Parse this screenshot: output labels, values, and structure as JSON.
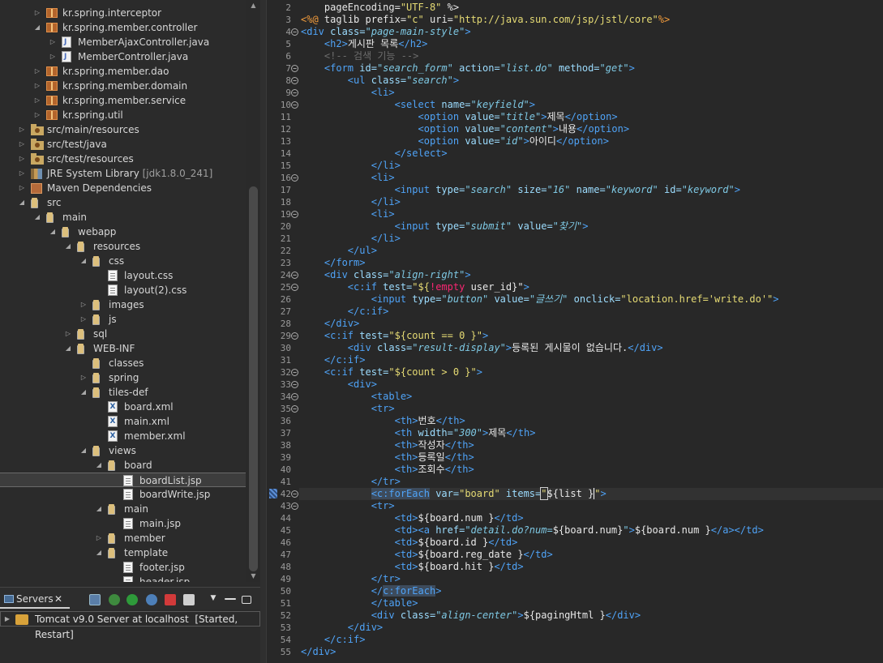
{
  "explorer": {
    "items": [
      {
        "label": "kr.spring.interceptor",
        "icon": "package-icon",
        "indent": 0,
        "expanded": false
      },
      {
        "label": "kr.spring.member.controller",
        "icon": "package-icon",
        "indent": 0,
        "expanded": true
      },
      {
        "label": "MemberAjaxController.java",
        "icon": "java-file-icon",
        "indent": 1,
        "expanded": false
      },
      {
        "label": "MemberController.java",
        "icon": "java-file-icon",
        "indent": 1,
        "expanded": false
      },
      {
        "label": "kr.spring.member.dao",
        "icon": "package-icon",
        "indent": 0,
        "expanded": false
      },
      {
        "label": "kr.spring.member.domain",
        "icon": "package-icon",
        "indent": 0,
        "expanded": false
      },
      {
        "label": "kr.spring.member.service",
        "icon": "package-icon",
        "indent": 0,
        "expanded": false
      },
      {
        "label": "kr.spring.util",
        "icon": "package-icon",
        "indent": 0,
        "expanded": false
      },
      {
        "label": "src/main/resources",
        "icon": "source-folder-icon",
        "indent": -1,
        "expanded": false
      },
      {
        "label": "src/test/java",
        "icon": "source-folder-icon",
        "indent": -1,
        "expanded": false
      },
      {
        "label": "src/test/resources",
        "icon": "source-folder-icon",
        "indent": -1,
        "expanded": false
      },
      {
        "label": "JRE System Library",
        "suffix": "[jdk1.8.0_241]",
        "icon": "library-icon",
        "indent": -1,
        "expanded": false
      },
      {
        "label": "Maven Dependencies",
        "icon": "maven-icon",
        "indent": -1,
        "expanded": false
      },
      {
        "label": "src",
        "icon": "folder-icon",
        "indent": -1,
        "expanded": true
      },
      {
        "label": "main",
        "icon": "folder-icon",
        "indent": 0,
        "expanded": true
      },
      {
        "label": "webapp",
        "icon": "folder-icon",
        "indent": 1,
        "expanded": true
      },
      {
        "label": "resources",
        "icon": "folder-icon",
        "indent": 2,
        "expanded": true
      },
      {
        "label": "css",
        "icon": "folder-icon",
        "indent": 3,
        "expanded": true
      },
      {
        "label": "layout.css",
        "icon": "file-icon",
        "indent": 4,
        "expanded": null
      },
      {
        "label": "layout(2).css",
        "icon": "file-icon",
        "indent": 4,
        "expanded": null
      },
      {
        "label": "images",
        "icon": "folder-icon",
        "indent": 3,
        "expanded": false
      },
      {
        "label": "js",
        "icon": "folder-icon",
        "indent": 3,
        "expanded": false
      },
      {
        "label": "sql",
        "icon": "folder-icon",
        "indent": 2,
        "expanded": false
      },
      {
        "label": "WEB-INF",
        "icon": "folder-icon",
        "indent": 2,
        "expanded": true
      },
      {
        "label": "classes",
        "icon": "folder-icon",
        "indent": 3,
        "expanded": null
      },
      {
        "label": "spring",
        "icon": "folder-icon",
        "indent": 3,
        "expanded": false
      },
      {
        "label": "tiles-def",
        "icon": "folder-icon",
        "indent": 3,
        "expanded": true
      },
      {
        "label": "board.xml",
        "icon": "xml-file-icon",
        "indent": 4,
        "expanded": null
      },
      {
        "label": "main.xml",
        "icon": "xml-file-icon",
        "indent": 4,
        "expanded": null
      },
      {
        "label": "member.xml",
        "icon": "xml-file-icon",
        "indent": 4,
        "expanded": null
      },
      {
        "label": "views",
        "icon": "folder-icon",
        "indent": 3,
        "expanded": true
      },
      {
        "label": "board",
        "icon": "folder-icon",
        "indent": 4,
        "expanded": true
      },
      {
        "label": "boardList.jsp",
        "icon": "jsp-file-icon",
        "indent": 5,
        "expanded": null,
        "selected": true
      },
      {
        "label": "boardWrite.jsp",
        "icon": "jsp-file-icon",
        "indent": 5,
        "expanded": null
      },
      {
        "label": "main",
        "icon": "folder-icon",
        "indent": 4,
        "expanded": true
      },
      {
        "label": "main.jsp",
        "icon": "jsp-file-icon",
        "indent": 5,
        "expanded": null
      },
      {
        "label": "member",
        "icon": "folder-icon",
        "indent": 4,
        "expanded": false
      },
      {
        "label": "template",
        "icon": "folder-icon",
        "indent": 4,
        "expanded": true
      },
      {
        "label": "footer.jsp",
        "icon": "jsp-file-icon",
        "indent": 5,
        "expanded": null
      },
      {
        "label": "header.jsp",
        "icon": "jsp-file-icon",
        "indent": 5,
        "expanded": null
      }
    ]
  },
  "servers": {
    "tab_label": "Servers",
    "close_glyph": "✕",
    "server_label": "Tomcat v9.0 Server at localhost",
    "server_status": "[Started, Restart]"
  },
  "editor": {
    "lines": [
      {
        "n": "2",
        "fold": false,
        "html": "    <span style='color:#e8e8e8'>pageEncoding=</span><span style='color:#e6db74'>\"UTF-8\"</span><span style='color:#e8e8e8'> %&gt;</span>"
      },
      {
        "n": "3",
        "fold": false,
        "html": "<span style='color:#f39c3c'>&lt;%@</span> <span style='color:#e8e8e8'>taglib prefix=</span><span style='color:#e6db74'>\"c\"</span> <span style='color:#e8e8e8'>uri=</span><span style='color:#e6db74'>\"http://java.sun.com/jsp/jstl/core\"</span><span style='color:#f39c3c'>%&gt;</span>"
      },
      {
        "n": "4",
        "fold": true,
        "html": "<span style='color:#4fa3f7'>&lt;div</span> <span style='color:#9cdcfe'>class=</span><span style='color:#7ec8e3;font-style:italic'>\"page-main-style\"</span><span style='color:#4fa3f7'>&gt;</span>"
      },
      {
        "n": "5",
        "fold": false,
        "html": "    <span style='color:#4fa3f7'>&lt;h2&gt;</span>게시판 목록<span style='color:#4fa3f7'>&lt;/h2&gt;</span>"
      },
      {
        "n": "6",
        "fold": false,
        "html": "    <span style='color:#6d6d6d'>&lt;!-- 검색 기능 --&gt;</span>"
      },
      {
        "n": "7",
        "fold": true,
        "html": "    <span style='color:#4fa3f7'>&lt;form</span> <span style='color:#9cdcfe'>id=</span><span style='color:#7ec8e3;font-style:italic'>\"search_form\"</span> <span style='color:#9cdcfe'>action=</span><span style='color:#7ec8e3;font-style:italic'>\"list.do\"</span> <span style='color:#9cdcfe'>method=</span><span style='color:#7ec8e3;font-style:italic'>\"get\"</span><span style='color:#4fa3f7'>&gt;</span>"
      },
      {
        "n": "8",
        "fold": true,
        "html": "        <span style='color:#4fa3f7'>&lt;ul</span> <span style='color:#9cdcfe'>class=</span><span style='color:#7ec8e3;font-style:italic'>\"search\"</span><span style='color:#4fa3f7'>&gt;</span>"
      },
      {
        "n": "9",
        "fold": true,
        "html": "            <span style='color:#4fa3f7'>&lt;li&gt;</span>"
      },
      {
        "n": "10",
        "fold": true,
        "html": "                <span style='color:#4fa3f7'>&lt;select</span> <span style='color:#9cdcfe'>name=</span><span style='color:#7ec8e3;font-style:italic'>\"keyfield\"</span><span style='color:#4fa3f7'>&gt;</span>"
      },
      {
        "n": "11",
        "fold": false,
        "html": "                    <span style='color:#4fa3f7'>&lt;option</span> <span style='color:#9cdcfe'>value=</span><span style='color:#7ec8e3;font-style:italic'>\"title\"</span><span style='color:#4fa3f7'>&gt;</span>제목<span style='color:#4fa3f7'>&lt;/option&gt;</span>"
      },
      {
        "n": "12",
        "fold": false,
        "html": "                    <span style='color:#4fa3f7'>&lt;option</span> <span style='color:#9cdcfe'>value=</span><span style='color:#7ec8e3;font-style:italic'>\"content\"</span><span style='color:#4fa3f7'>&gt;</span>내용<span style='color:#4fa3f7'>&lt;/option&gt;</span>"
      },
      {
        "n": "13",
        "fold": false,
        "html": "                    <span style='color:#4fa3f7'>&lt;option</span> <span style='color:#9cdcfe'>value=</span><span style='color:#7ec8e3;font-style:italic'>\"id\"</span><span style='color:#4fa3f7'>&gt;</span>아이디<span style='color:#4fa3f7'>&lt;/option&gt;</span>"
      },
      {
        "n": "14",
        "fold": false,
        "html": "                <span style='color:#4fa3f7'>&lt;/select&gt;</span>"
      },
      {
        "n": "15",
        "fold": false,
        "html": "            <span style='color:#4fa3f7'>&lt;/li&gt;</span>"
      },
      {
        "n": "16",
        "fold": true,
        "html": "            <span style='color:#4fa3f7'>&lt;li&gt;</span>"
      },
      {
        "n": "17",
        "fold": false,
        "html": "                <span style='color:#4fa3f7'>&lt;input</span> <span style='color:#9cdcfe'>type=</span><span style='color:#7ec8e3;font-style:italic'>\"search\"</span> <span style='color:#9cdcfe'>size=</span><span style='color:#7ec8e3;font-style:italic'>\"16\"</span> <span style='color:#9cdcfe'>name=</span><span style='color:#7ec8e3;font-style:italic'>\"keyword\"</span> <span style='color:#9cdcfe'>id=</span><span style='color:#7ec8e3;font-style:italic'>\"keyword\"</span><span style='color:#4fa3f7'>&gt;</span>"
      },
      {
        "n": "18",
        "fold": false,
        "html": "            <span style='color:#4fa3f7'>&lt;/li&gt;</span>"
      },
      {
        "n": "19",
        "fold": true,
        "html": "            <span style='color:#4fa3f7'>&lt;li&gt;</span>"
      },
      {
        "n": "20",
        "fold": false,
        "html": "                <span style='color:#4fa3f7'>&lt;input</span> <span style='color:#9cdcfe'>type=</span><span style='color:#7ec8e3;font-style:italic'>\"submit\"</span> <span style='color:#9cdcfe'>value=</span><span style='color:#7ec8e3;font-style:italic'>\"찾기\"</span><span style='color:#4fa3f7'>&gt;</span>"
      },
      {
        "n": "21",
        "fold": false,
        "html": "            <span style='color:#4fa3f7'>&lt;/li&gt;</span>"
      },
      {
        "n": "22",
        "fold": false,
        "html": "        <span style='color:#4fa3f7'>&lt;/ul&gt;</span>"
      },
      {
        "n": "23",
        "fold": false,
        "html": "    <span style='color:#4fa3f7'>&lt;/form&gt;</span>"
      },
      {
        "n": "24",
        "fold": true,
        "html": "    <span style='color:#4fa3f7'>&lt;div</span> <span style='color:#9cdcfe'>class=</span><span style='color:#7ec8e3;font-style:italic'>\"align-right\"</span><span style='color:#4fa3f7'>&gt;</span>"
      },
      {
        "n": "25",
        "fold": true,
        "html": "        <span style='color:#4fa3f7'>&lt;c:if</span> <span style='color:#9cdcfe'>test=</span><span style='color:#e6db74'>\"${</span><span style='color:#f92672'>!empty</span> <span style='color:#e8e8e8'>user_id}\"</span><span style='color:#4fa3f7'>&gt;</span>"
      },
      {
        "n": "26",
        "fold": false,
        "html": "            <span style='color:#4fa3f7'>&lt;input</span> <span style='color:#9cdcfe'>type=</span><span style='color:#7ec8e3;font-style:italic'>\"button\"</span> <span style='color:#9cdcfe'>value=</span><span style='color:#7ec8e3;font-style:italic'>\"글쓰기\"</span> <span style='color:#9cdcfe'>onclick=</span><span style='color:#e6db74'>\"location.href='write.do'\"</span><span style='color:#4fa3f7'>&gt;</span>"
      },
      {
        "n": "27",
        "fold": false,
        "html": "        <span style='color:#4fa3f7'>&lt;/c:if&gt;</span>"
      },
      {
        "n": "28",
        "fold": false,
        "html": "    <span style='color:#4fa3f7'>&lt;/div&gt;</span>"
      },
      {
        "n": "29",
        "fold": true,
        "html": "    <span style='color:#4fa3f7'>&lt;c:if</span> <span style='color:#9cdcfe'>test=</span><span style='color:#e6db74'>\"${count == 0 }\"</span><span style='color:#4fa3f7'>&gt;</span>"
      },
      {
        "n": "30",
        "fold": false,
        "html": "        <span style='color:#4fa3f7'>&lt;div</span> <span style='color:#9cdcfe'>class=</span><span style='color:#7ec8e3;font-style:italic'>\"result-display\"</span><span style='color:#4fa3f7'>&gt;</span>등록된 게시물이 없습니다.<span style='color:#4fa3f7'>&lt;/div&gt;</span>"
      },
      {
        "n": "31",
        "fold": false,
        "html": "    <span style='color:#4fa3f7'>&lt;/c:if&gt;</span>"
      },
      {
        "n": "32",
        "fold": true,
        "html": "    <span style='color:#4fa3f7'>&lt;c:if</span> <span style='color:#9cdcfe'>test=</span><span style='color:#e6db74'>\"${count &gt; 0 }\"</span><span style='color:#4fa3f7'>&gt;</span>"
      },
      {
        "n": "33",
        "fold": true,
        "html": "        <span style='color:#4fa3f7'>&lt;div&gt;</span>"
      },
      {
        "n": "34",
        "fold": true,
        "html": "            <span style='color:#4fa3f7'>&lt;table&gt;</span>"
      },
      {
        "n": "35",
        "fold": true,
        "html": "            <span style='color:#4fa3f7'>&lt;tr&gt;</span>"
      },
      {
        "n": "36",
        "fold": false,
        "html": "                <span style='color:#4fa3f7'>&lt;th&gt;</span>번호<span style='color:#4fa3f7'>&lt;/th&gt;</span>"
      },
      {
        "n": "37",
        "fold": false,
        "html": "                <span style='color:#4fa3f7'>&lt;th</span> <span style='color:#9cdcfe'>width=</span><span style='color:#7ec8e3;font-style:italic'>\"300\"</span><span style='color:#4fa3f7'>&gt;</span>제목<span style='color:#4fa3f7'>&lt;/th&gt;</span>"
      },
      {
        "n": "38",
        "fold": false,
        "html": "                <span style='color:#4fa3f7'>&lt;th&gt;</span>작성자<span style='color:#4fa3f7'>&lt;/th&gt;</span>"
      },
      {
        "n": "39",
        "fold": false,
        "html": "                <span style='color:#4fa3f7'>&lt;th&gt;</span>등록일<span style='color:#4fa3f7'>&lt;/th&gt;</span>"
      },
      {
        "n": "40",
        "fold": false,
        "html": "                <span style='color:#4fa3f7'>&lt;th&gt;</span>조회수<span style='color:#4fa3f7'>&lt;/th&gt;</span>"
      },
      {
        "n": "41",
        "fold": false,
        "html": "            <span style='color:#4fa3f7'>&lt;/tr&gt;</span>"
      },
      {
        "n": "42",
        "fold": true,
        "current": true,
        "html": "            <span style='color:#4fa3f7;background:#3d4b5c'>&lt;c:forEach</span> <span style='color:#9cdcfe'>var=</span><span style='color:#e6db74'>\"board\"</span> <span style='color:#9cdcfe'>items=</span><span style='color:#e6db74;outline:1px solid #cfcfcf'>\"</span><span style='color:#e8e8e8'>${list }</span><span style='color:#e6db74;border-left:1px solid #ffffff'>\"</span><span style='color:#4fa3f7'>&gt;</span>"
      },
      {
        "n": "43",
        "fold": true,
        "html": "            <span style='color:#4fa3f7'>&lt;tr&gt;</span>"
      },
      {
        "n": "44",
        "fold": false,
        "html": "                <span style='color:#4fa3f7'>&lt;td&gt;</span>${board.num }<span style='color:#4fa3f7'>&lt;/td&gt;</span>"
      },
      {
        "n": "45",
        "fold": false,
        "html": "                <span style='color:#4fa3f7'>&lt;td&gt;&lt;a</span> <span style='color:#9cdcfe'>href=</span><span style='color:#7ec8e3;font-style:italic'>\"detail.do?num=</span>${board.num}<span style='color:#7ec8e3;font-style:italic'>\"</span><span style='color:#4fa3f7'>&gt;</span>${board.num }<span style='color:#4fa3f7'>&lt;/a&gt;&lt;/td&gt;</span>"
      },
      {
        "n": "46",
        "fold": false,
        "html": "                <span style='color:#4fa3f7'>&lt;td&gt;</span>${board.id }<span style='color:#4fa3f7'>&lt;/td&gt;</span>"
      },
      {
        "n": "47",
        "fold": false,
        "html": "                <span style='color:#4fa3f7'>&lt;td&gt;</span>${board.reg_date }<span style='color:#4fa3f7'>&lt;/td&gt;</span>"
      },
      {
        "n": "48",
        "fold": false,
        "html": "                <span style='color:#4fa3f7'>&lt;td&gt;</span>${board.hit }<span style='color:#4fa3f7'>&lt;/td&gt;</span>"
      },
      {
        "n": "49",
        "fold": false,
        "html": "            <span style='color:#4fa3f7'>&lt;/tr&gt;</span>"
      },
      {
        "n": "50",
        "fold": false,
        "html": "            <span style='color:#4fa3f7'>&lt;/</span><span style='color:#4fa3f7;background:#3d4b5c'>c:forEach</span><span style='color:#4fa3f7'>&gt;</span>"
      },
      {
        "n": "51",
        "fold": false,
        "html": "            <span style='color:#4fa3f7'>&lt;/table&gt;</span>"
      },
      {
        "n": "52",
        "fold": false,
        "html": "            <span style='color:#4fa3f7'>&lt;div</span> <span style='color:#9cdcfe'>class=</span><span style='color:#7ec8e3;font-style:italic'>\"align-center\"</span><span style='color:#4fa3f7'>&gt;</span>${pagingHtml }<span style='color:#4fa3f7'>&lt;/div&gt;</span>"
      },
      {
        "n": "53",
        "fold": false,
        "html": "        <span style='color:#4fa3f7'>&lt;/div&gt;</span>"
      },
      {
        "n": "54",
        "fold": false,
        "html": "    <span style='color:#4fa3f7'>&lt;/c:if&gt;</span>"
      },
      {
        "n": "55",
        "fold": false,
        "html": "<span style='color:#4fa3f7'>&lt;/div&gt;</span>"
      }
    ]
  }
}
